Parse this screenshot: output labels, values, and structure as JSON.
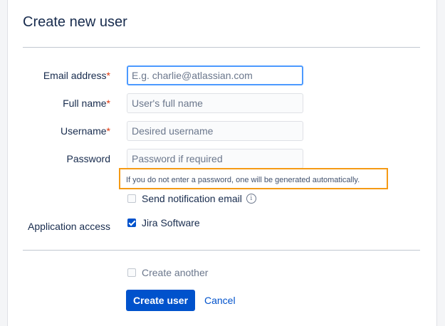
{
  "dialog": {
    "title": "Create new user"
  },
  "form": {
    "email": {
      "label": "Email address",
      "required_mark": "*",
      "placeholder": "E.g. charlie@atlassian.com",
      "value": ""
    },
    "full_name": {
      "label": "Full name",
      "required_mark": "*",
      "placeholder": "User's full name",
      "value": ""
    },
    "username": {
      "label": "Username",
      "required_mark": "*",
      "placeholder": "Desired username",
      "value": ""
    },
    "password": {
      "label": "Password",
      "placeholder": "Password if required",
      "value": ""
    },
    "password_hint": "If you do not enter a password, one will be generated automatically.",
    "send_notification": {
      "label": "Send notification email",
      "checked": false,
      "icon": "info-icon"
    },
    "application_access": {
      "label": "Application access",
      "option_label": "Jira Software",
      "checked": true
    },
    "create_another": {
      "label": "Create another",
      "checked": false
    }
  },
  "actions": {
    "create_label": "Create user",
    "cancel_label": "Cancel"
  },
  "colors": {
    "primary": "#0052cc",
    "required": "#de350b",
    "highlight": "#f59a14"
  }
}
